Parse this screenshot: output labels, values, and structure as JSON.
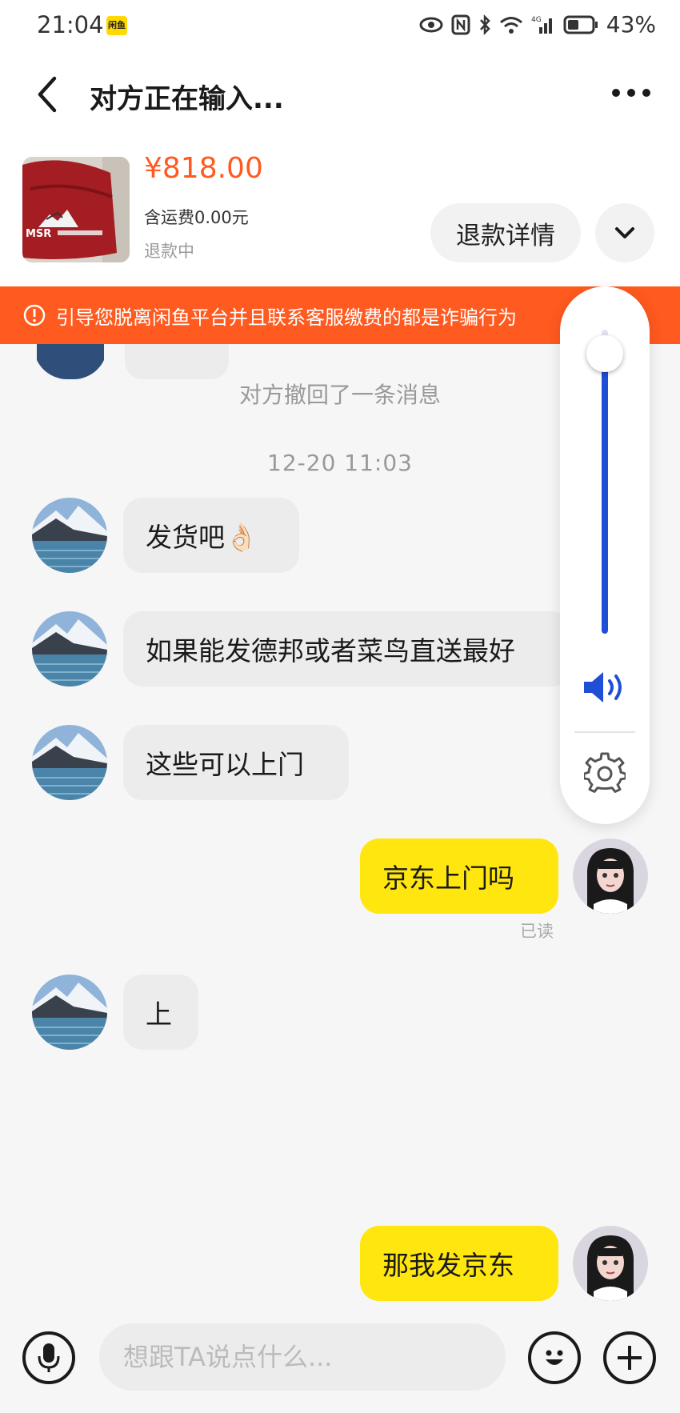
{
  "status_bar": {
    "time": "21:04",
    "app_badge": "闲鱼",
    "battery": "43%",
    "network": "4G"
  },
  "header": {
    "title": "对方正在输入..."
  },
  "product": {
    "price": "¥818.00",
    "shipping": "含运费0.00元",
    "status": "退款中",
    "refund_button": "退款详情",
    "thumb_text": "MSR"
  },
  "warning": {
    "text": "引导您脱离闲鱼平台并且联系客服缴费的都是诈骗行为"
  },
  "chat": {
    "system_message": "对方撤回了一条消息",
    "timestamp": "12-20 11:03",
    "messages": [
      {
        "side": "in",
        "text": "发货吧👌🏻"
      },
      {
        "side": "in",
        "text": "如果能发德邦或者菜鸟直送最好"
      },
      {
        "side": "in",
        "text": "这些可以上门"
      },
      {
        "side": "out",
        "text": "京东上门吗",
        "receipt": "已读"
      },
      {
        "side": "in",
        "text": "上"
      },
      {
        "side": "out",
        "text": "那我发京东"
      }
    ]
  },
  "input": {
    "placeholder": "想跟TA说点什么..."
  },
  "volume": {
    "level": 0.92
  },
  "colors": {
    "accent_orange": "#ff5a1f",
    "bubble_out": "#ffe60f",
    "volume_blue": "#1f4fd6"
  }
}
